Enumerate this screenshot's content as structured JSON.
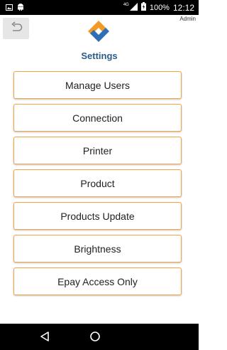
{
  "status_bar": {
    "network": "4G",
    "battery": "100%",
    "time": "12:12"
  },
  "header": {
    "user": "Admin",
    "title": "Settings"
  },
  "menu": [
    {
      "label": "Manage Users"
    },
    {
      "label": "Connection"
    },
    {
      "label": "Printer"
    },
    {
      "label": "Product"
    },
    {
      "label": "Products Update"
    },
    {
      "label": "Brightness"
    },
    {
      "label": "Epay Access Only"
    }
  ],
  "icons": {
    "back": "back-arrow-icon",
    "logo": "app-logo",
    "nav_back": "triangle-back-icon",
    "nav_home": "circle-home-icon"
  },
  "colors": {
    "accent_border": "#f0a646",
    "title": "#2a5c8a",
    "logo_orange": "#f29a26",
    "logo_blue": "#2f6fb5"
  }
}
